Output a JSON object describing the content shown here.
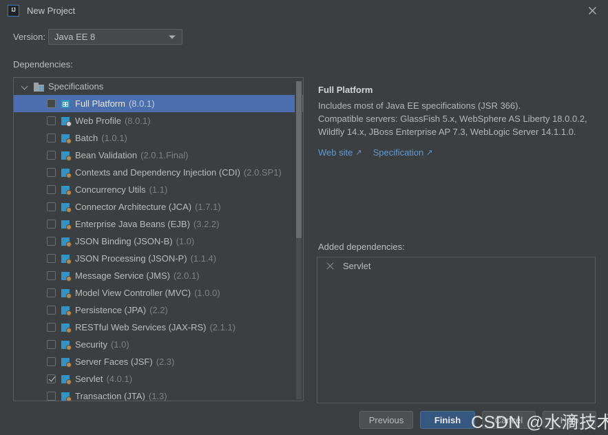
{
  "window": {
    "title": "New Project",
    "logo_text": "IJ",
    "close_icon": "close-icon"
  },
  "version": {
    "label": "Version:",
    "value": "Java EE 8",
    "arrow_icon": "chevron-down-icon"
  },
  "dependencies": {
    "label": "Dependencies:",
    "root": {
      "label": "Specifications",
      "expander_icon": "chevron-down-icon",
      "folder_icon": "specifications-folder-icon"
    },
    "items": [
      {
        "name": "Full Platform",
        "version": "(8.0.1)",
        "checked": false,
        "selected": true,
        "icon": "platform-icon"
      },
      {
        "name": "Web Profile",
        "version": "(8.0.1)",
        "checked": false,
        "selected": false,
        "icon": "web-profile-icon"
      },
      {
        "name": "Batch",
        "version": "(1.0.1)",
        "checked": false,
        "selected": false,
        "icon": "spec-icon"
      },
      {
        "name": "Bean Validation",
        "version": "(2.0.1.Final)",
        "checked": false,
        "selected": false,
        "icon": "spec-icon"
      },
      {
        "name": "Contexts and Dependency Injection (CDI)",
        "version": "(2.0.SP1)",
        "checked": false,
        "selected": false,
        "icon": "spec-icon"
      },
      {
        "name": "Concurrency Utils",
        "version": "(1.1)",
        "checked": false,
        "selected": false,
        "icon": "spec-icon"
      },
      {
        "name": "Connector Architecture (JCA)",
        "version": "(1.7.1)",
        "checked": false,
        "selected": false,
        "icon": "spec-icon"
      },
      {
        "name": "Enterprise Java Beans (EJB)",
        "version": "(3.2.2)",
        "checked": false,
        "selected": false,
        "icon": "spec-icon"
      },
      {
        "name": "JSON Binding (JSON-B)",
        "version": "(1.0)",
        "checked": false,
        "selected": false,
        "icon": "spec-icon"
      },
      {
        "name": "JSON Processing (JSON-P)",
        "version": "(1.1.4)",
        "checked": false,
        "selected": false,
        "icon": "spec-icon"
      },
      {
        "name": "Message Service (JMS)",
        "version": "(2.0.1)",
        "checked": false,
        "selected": false,
        "icon": "spec-icon"
      },
      {
        "name": "Model View Controller (MVC)",
        "version": "(1.0.0)",
        "checked": false,
        "selected": false,
        "icon": "spec-icon"
      },
      {
        "name": "Persistence (JPA)",
        "version": "(2.2)",
        "checked": false,
        "selected": false,
        "icon": "spec-icon"
      },
      {
        "name": "RESTful Web Services (JAX-RS)",
        "version": "(2.1.1)",
        "checked": false,
        "selected": false,
        "icon": "spec-icon"
      },
      {
        "name": "Security",
        "version": "(1.0)",
        "checked": false,
        "selected": false,
        "icon": "spec-icon"
      },
      {
        "name": "Server Faces (JSF)",
        "version": "(2.3)",
        "checked": false,
        "selected": false,
        "icon": "spec-icon"
      },
      {
        "name": "Servlet",
        "version": "(4.0.1)",
        "checked": true,
        "selected": false,
        "icon": "spec-icon"
      },
      {
        "name": "Transaction (JTA)",
        "version": "(1.3)",
        "checked": false,
        "selected": false,
        "icon": "spec-icon"
      }
    ]
  },
  "detail": {
    "title": "Full Platform",
    "description": "Includes most of Java EE specifications (JSR 366).\nCompatible servers: GlassFish 5.x, WebSphere AS Liberty 18.0.0.2, Wildfly 14.x, JBoss Enterprise AP 7.3, WebLogic Server 14.1.1.0.",
    "links": [
      {
        "label": "Web site",
        "arrow": "↗",
        "icon": "external-link-icon"
      },
      {
        "label": "Specification",
        "arrow": "↗",
        "icon": "external-link-icon"
      }
    ]
  },
  "added": {
    "label": "Added dependencies:",
    "items": [
      {
        "name": "Servlet",
        "remove_icon": "close-icon"
      }
    ]
  },
  "buttons": {
    "previous": "Previous",
    "finish": "Finish",
    "cancel": "Cancel",
    "help": "Help"
  },
  "watermark": "CSDN @水滴技术",
  "colors": {
    "background": "#3c3f41",
    "selection": "#4b6eaf",
    "accent_button": "#365880",
    "link": "#5b9bd5",
    "spec_icon": "#3592c4",
    "text": "#bbbbbb",
    "muted_text": "#7e8183"
  }
}
